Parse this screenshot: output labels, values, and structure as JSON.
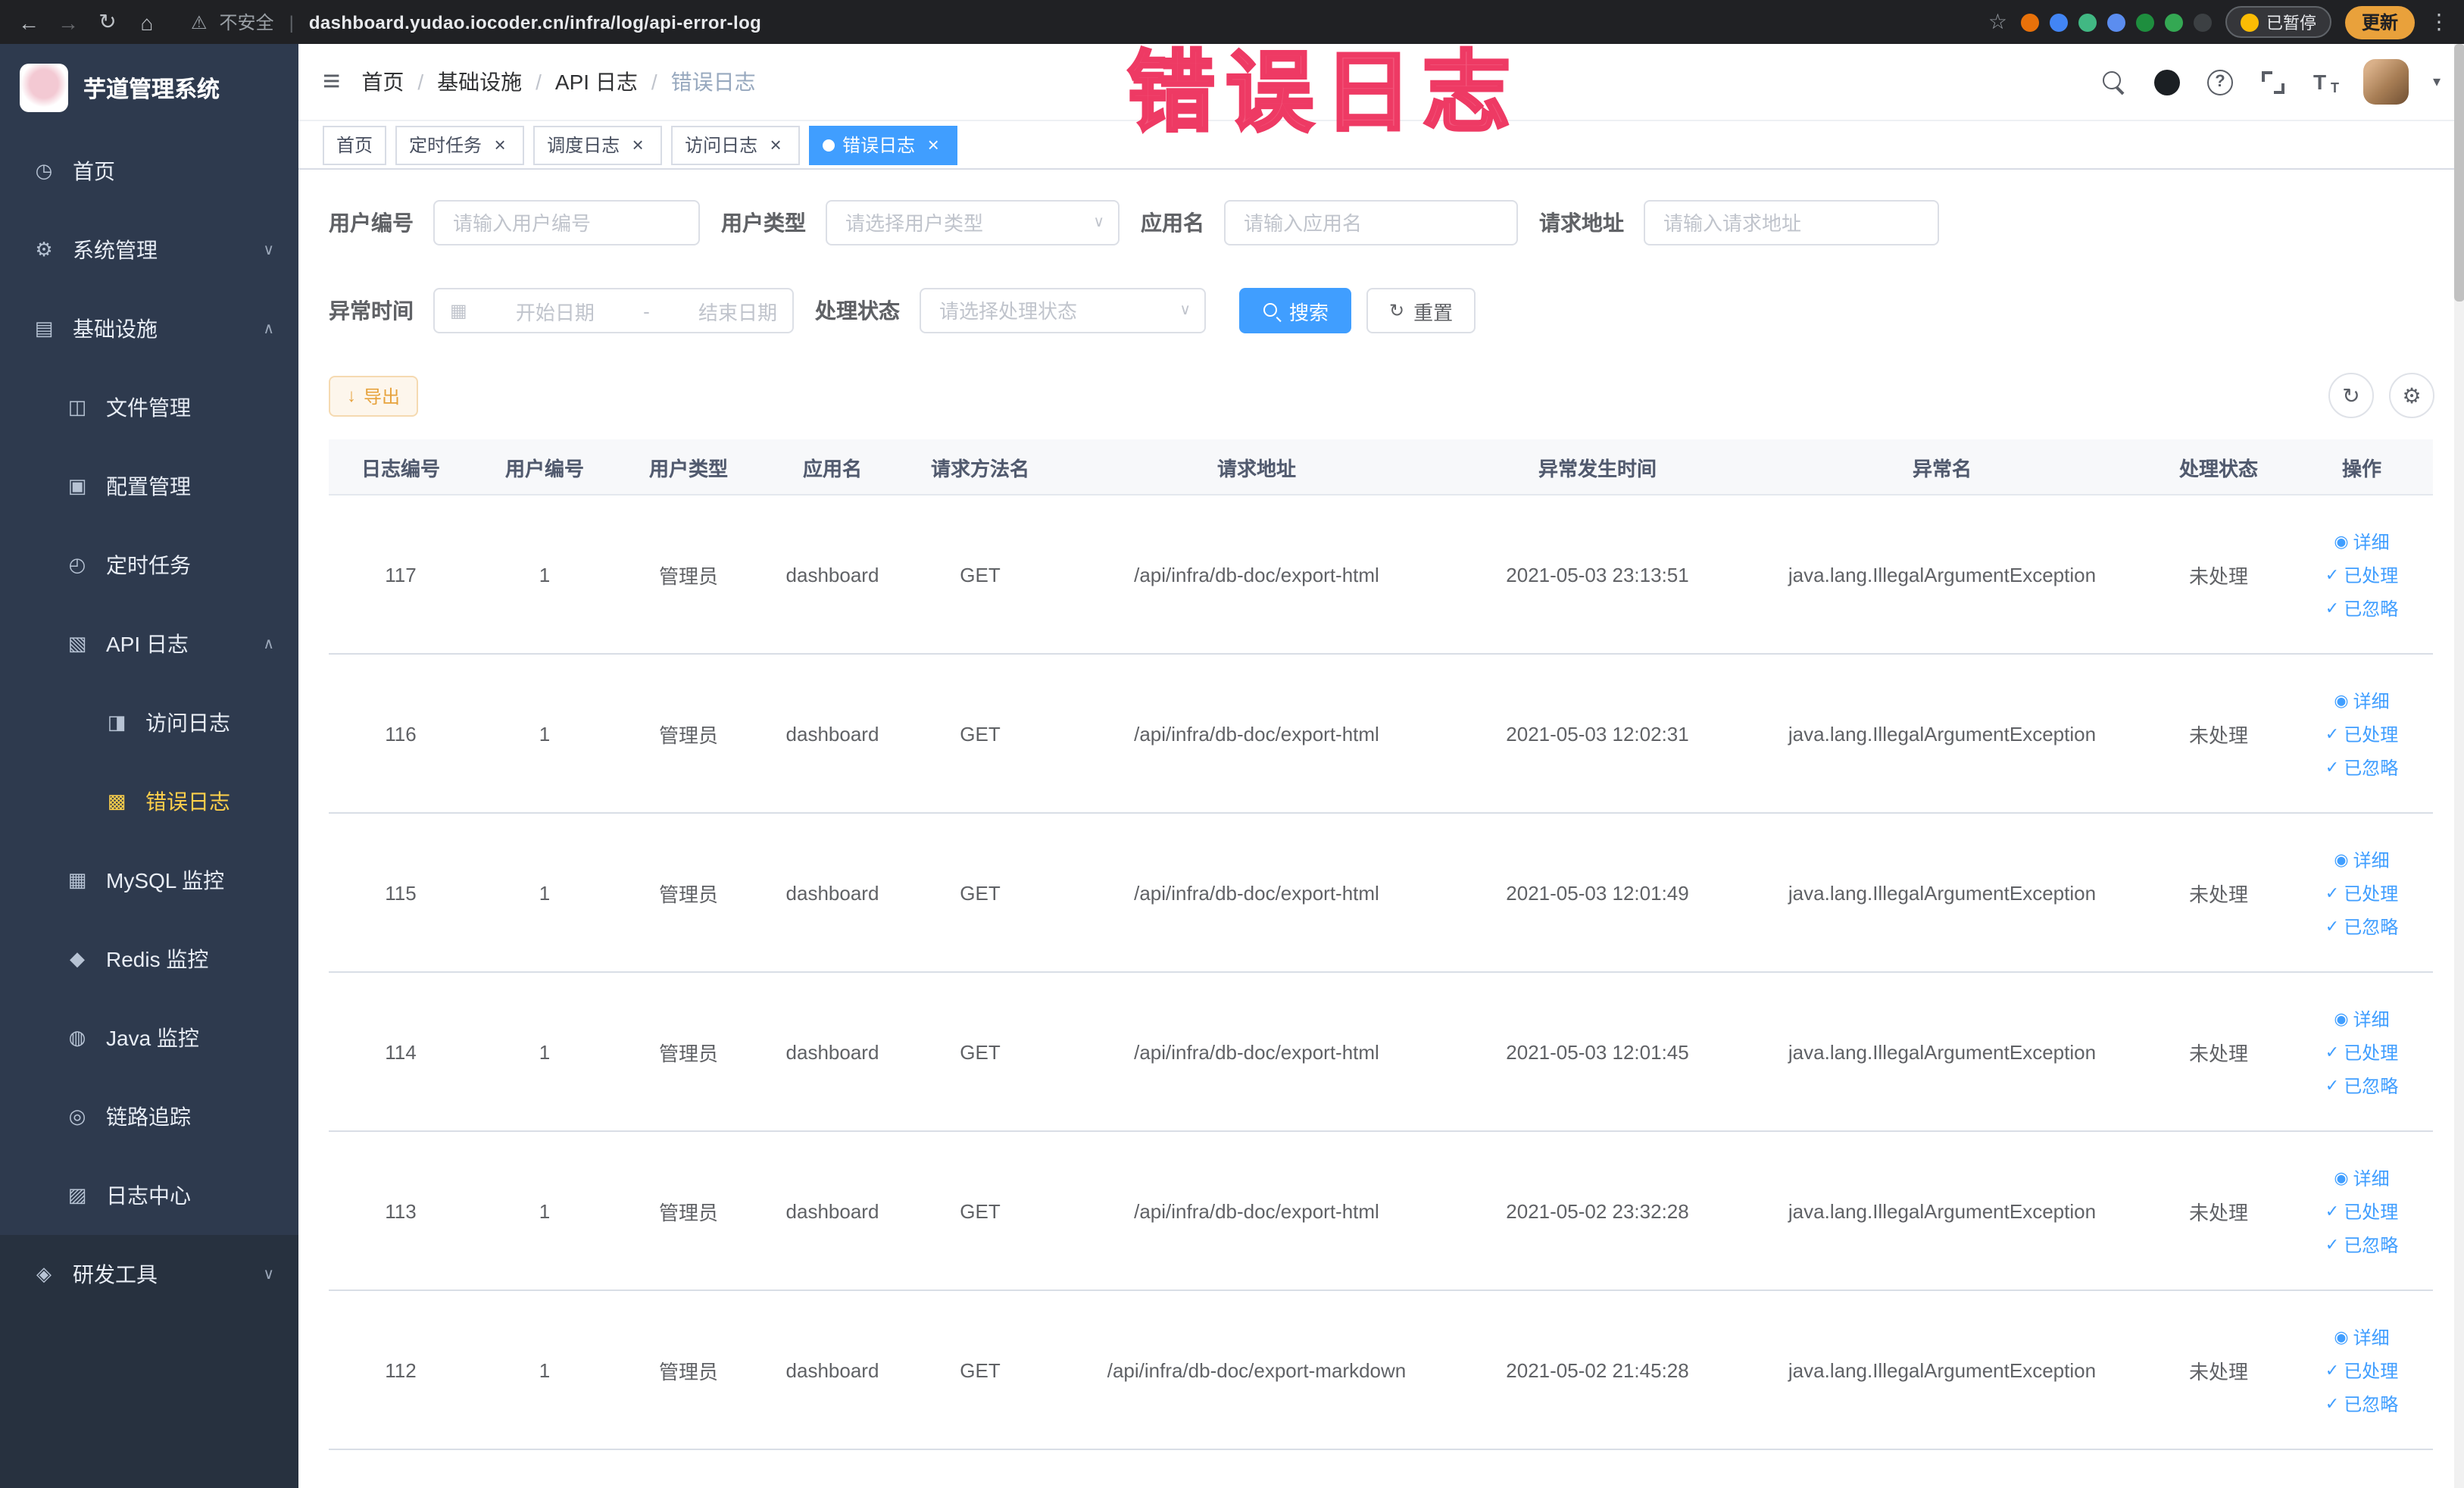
{
  "browser": {
    "security_label": "不安全",
    "url": "dashboard.yudao.iocoder.cn/infra/log/api-error-log",
    "paused_badge": "已暂停",
    "update_button": "更新",
    "extensions": [
      {
        "name": "extension-orange-icon",
        "color": "#e8710a"
      },
      {
        "name": "extension-blue-drop-icon",
        "color": "#4285f4"
      },
      {
        "name": "extension-vue-devtools-icon",
        "color": "#41b883"
      },
      {
        "name": "extension-grid-icon",
        "color": "#5b8def"
      },
      {
        "name": "extension-on-badge-icon",
        "color": "#1e8e3e"
      },
      {
        "name": "extension-leaf-icon",
        "color": "#34a853"
      },
      {
        "name": "extension-paw-icon",
        "color": "#3c4043"
      }
    ]
  },
  "annotation": {
    "text": "错误日志",
    "color": "#f2557a"
  },
  "sidebar": {
    "logo_title": "芋道管理系统",
    "items": [
      {
        "name": "home",
        "label": "首页",
        "icon": "dashboard-icon",
        "level": 1
      },
      {
        "name": "system",
        "label": "系统管理",
        "icon": "gear-icon",
        "level": 1,
        "arrow": "down"
      },
      {
        "name": "infra",
        "label": "基础设施",
        "icon": "infra-icon",
        "level": 1,
        "arrow": "up"
      },
      {
        "name": "file-manage",
        "label": "文件管理",
        "icon": "file-icon",
        "level": 2
      },
      {
        "name": "config-manage",
        "label": "配置管理",
        "icon": "config-icon",
        "level": 2
      },
      {
        "name": "scheduled-job",
        "label": "定时任务",
        "icon": "job-icon",
        "level": 2
      },
      {
        "name": "api-log",
        "label": "API 日志",
        "icon": "api-log-icon",
        "level": 2,
        "arrow": "up"
      },
      {
        "name": "access-log",
        "label": "访问日志",
        "icon": "access-log-icon",
        "level": 3
      },
      {
        "name": "error-log",
        "label": "错误日志",
        "icon": "error-log-icon",
        "level": 3,
        "active": true
      },
      {
        "name": "mysql-monitor",
        "label": "MySQL 监控",
        "icon": "mysql-icon",
        "level": 2
      },
      {
        "name": "redis-monitor",
        "label": "Redis 监控",
        "icon": "redis-icon",
        "level": 2
      },
      {
        "name": "java-monitor",
        "label": "Java 监控",
        "icon": "java-icon",
        "level": 2
      },
      {
        "name": "link-trace",
        "label": "链路追踪",
        "icon": "trace-icon",
        "level": 2
      },
      {
        "name": "log-center",
        "label": "日志中心",
        "icon": "log-center-icon",
        "level": 2
      },
      {
        "name": "dev-tools",
        "label": "研发工具",
        "icon": "tools-icon",
        "level": 1,
        "arrow": "down"
      }
    ]
  },
  "icon_glyphs": {
    "dashboard-icon": "◷",
    "gear-icon": "⚙",
    "infra-icon": "▤",
    "file-icon": "◫",
    "config-icon": "▣",
    "job-icon": "◴",
    "api-log-icon": "▧",
    "access-log-icon": "◨",
    "error-log-icon": "▩",
    "mysql-icon": "▦",
    "redis-icon": "◆",
    "java-icon": "◍",
    "trace-icon": "◎",
    "log-center-icon": "▨",
    "tools-icon": "◈"
  },
  "breadcrumb": [
    "首页",
    "基础设施",
    "API 日志",
    "错误日志"
  ],
  "navbar": {
    "icons": [
      "search-icon",
      "github-icon",
      "question-icon",
      "fullscreen-icon",
      "font-size-icon"
    ]
  },
  "tabs": [
    {
      "name": "home",
      "label": "首页",
      "closable": false
    },
    {
      "name": "scheduled-job",
      "label": "定时任务",
      "closable": true
    },
    {
      "name": "job-log",
      "label": "调度日志",
      "closable": true
    },
    {
      "name": "access-log",
      "label": "访问日志",
      "closable": true
    },
    {
      "name": "error-log",
      "label": "错误日志",
      "closable": true,
      "active": true
    }
  ],
  "filters": {
    "user_id": {
      "label": "用户编号",
      "placeholder": "请输入用户编号"
    },
    "user_type": {
      "label": "用户类型",
      "placeholder": "请选择用户类型"
    },
    "app_name": {
      "label": "应用名",
      "placeholder": "请输入应用名"
    },
    "request_url": {
      "label": "请求地址",
      "placeholder": "请输入请求地址"
    },
    "exception_time": {
      "label": "异常时间",
      "start_placeholder": "开始日期",
      "separator": "-",
      "end_placeholder": "结束日期"
    },
    "process_status": {
      "label": "处理状态",
      "placeholder": "请选择处理状态"
    },
    "search_button": "搜索",
    "reset_button": "重置"
  },
  "toolbar": {
    "export_button": "导出"
  },
  "table": {
    "columns": [
      "日志编号",
      "用户编号",
      "用户类型",
      "应用名",
      "请求方法名",
      "请求地址",
      "异常发生时间",
      "异常名",
      "处理状态",
      "操作"
    ],
    "actions": [
      {
        "name": "detail",
        "label": "详细",
        "icon": "eye-icon",
        "glyph": "◉"
      },
      {
        "name": "processed",
        "label": "已处理",
        "icon": "check-icon",
        "glyph": "✓"
      },
      {
        "name": "ignored",
        "label": "已忽略",
        "icon": "check-icon",
        "glyph": "✓"
      }
    ],
    "rows": [
      {
        "id": "117",
        "user_id": "1",
        "user_type": "管理员",
        "app": "dashboard",
        "method": "GET",
        "url": "/api/infra/db-doc/export-html",
        "time": "2021-05-03 23:13:51",
        "exception": "java.lang.IllegalArgumentException",
        "status": "未处理"
      },
      {
        "id": "116",
        "user_id": "1",
        "user_type": "管理员",
        "app": "dashboard",
        "method": "GET",
        "url": "/api/infra/db-doc/export-html",
        "time": "2021-05-03 12:02:31",
        "exception": "java.lang.IllegalArgumentException",
        "status": "未处理"
      },
      {
        "id": "115",
        "user_id": "1",
        "user_type": "管理员",
        "app": "dashboard",
        "method": "GET",
        "url": "/api/infra/db-doc/export-html",
        "time": "2021-05-03 12:01:49",
        "exception": "java.lang.IllegalArgumentException",
        "status": "未处理"
      },
      {
        "id": "114",
        "user_id": "1",
        "user_type": "管理员",
        "app": "dashboard",
        "method": "GET",
        "url": "/api/infra/db-doc/export-html",
        "time": "2021-05-03 12:01:45",
        "exception": "java.lang.IllegalArgumentException",
        "status": "未处理"
      },
      {
        "id": "113",
        "user_id": "1",
        "user_type": "管理员",
        "app": "dashboard",
        "method": "GET",
        "url": "/api/infra/db-doc/export-html",
        "time": "2021-05-02 23:32:28",
        "exception": "java.lang.IllegalArgumentException",
        "status": "未处理"
      },
      {
        "id": "112",
        "user_id": "1",
        "user_type": "管理员",
        "app": "dashboard",
        "method": "GET",
        "url": "/api/infra/db-doc/export-markdown",
        "time": "2021-05-02 21:45:28",
        "exception": "java.lang.IllegalArgumentException",
        "status": "未处理"
      }
    ]
  },
  "colors": {
    "primary": "#409eff",
    "warning": "#e6a23c",
    "sidebar_active": "#ffd04b",
    "tab_active": "#409eff"
  }
}
